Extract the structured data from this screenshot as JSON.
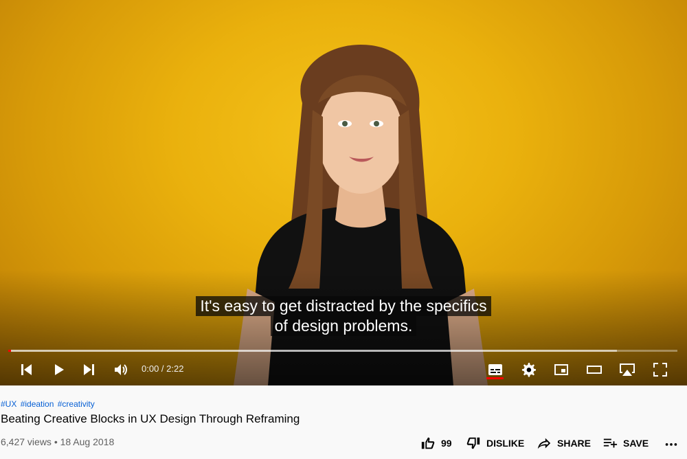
{
  "video": {
    "captions": [
      "It's easy to get distracted by the specifics",
      "of design problems."
    ],
    "progress": {
      "played_fraction": 0.004,
      "buffered_fraction": 0.91
    },
    "time_display": "0:00 / 2:22",
    "colors": {
      "background_yellow": "#eab10d",
      "progress_red": "#ff0000"
    },
    "controls": {
      "left": [
        "previous-icon",
        "play-icon",
        "next-icon",
        "volume-icon"
      ],
      "right": [
        "subtitles-icon",
        "settings-icon",
        "miniplayer-icon",
        "theater-mode-icon",
        "airplay-icon",
        "fullscreen-icon"
      ]
    }
  },
  "info": {
    "hashtags": [
      "#UX",
      "#ideation",
      "#creativity"
    ],
    "title": "Beating Creative Blocks in UX Design Through Reframing",
    "meta": "6,427 views • 18 Aug 2018",
    "actions": {
      "like_count": "99",
      "dislike_label": "DISLIKE",
      "share_label": "SHARE",
      "save_label": "SAVE"
    }
  }
}
